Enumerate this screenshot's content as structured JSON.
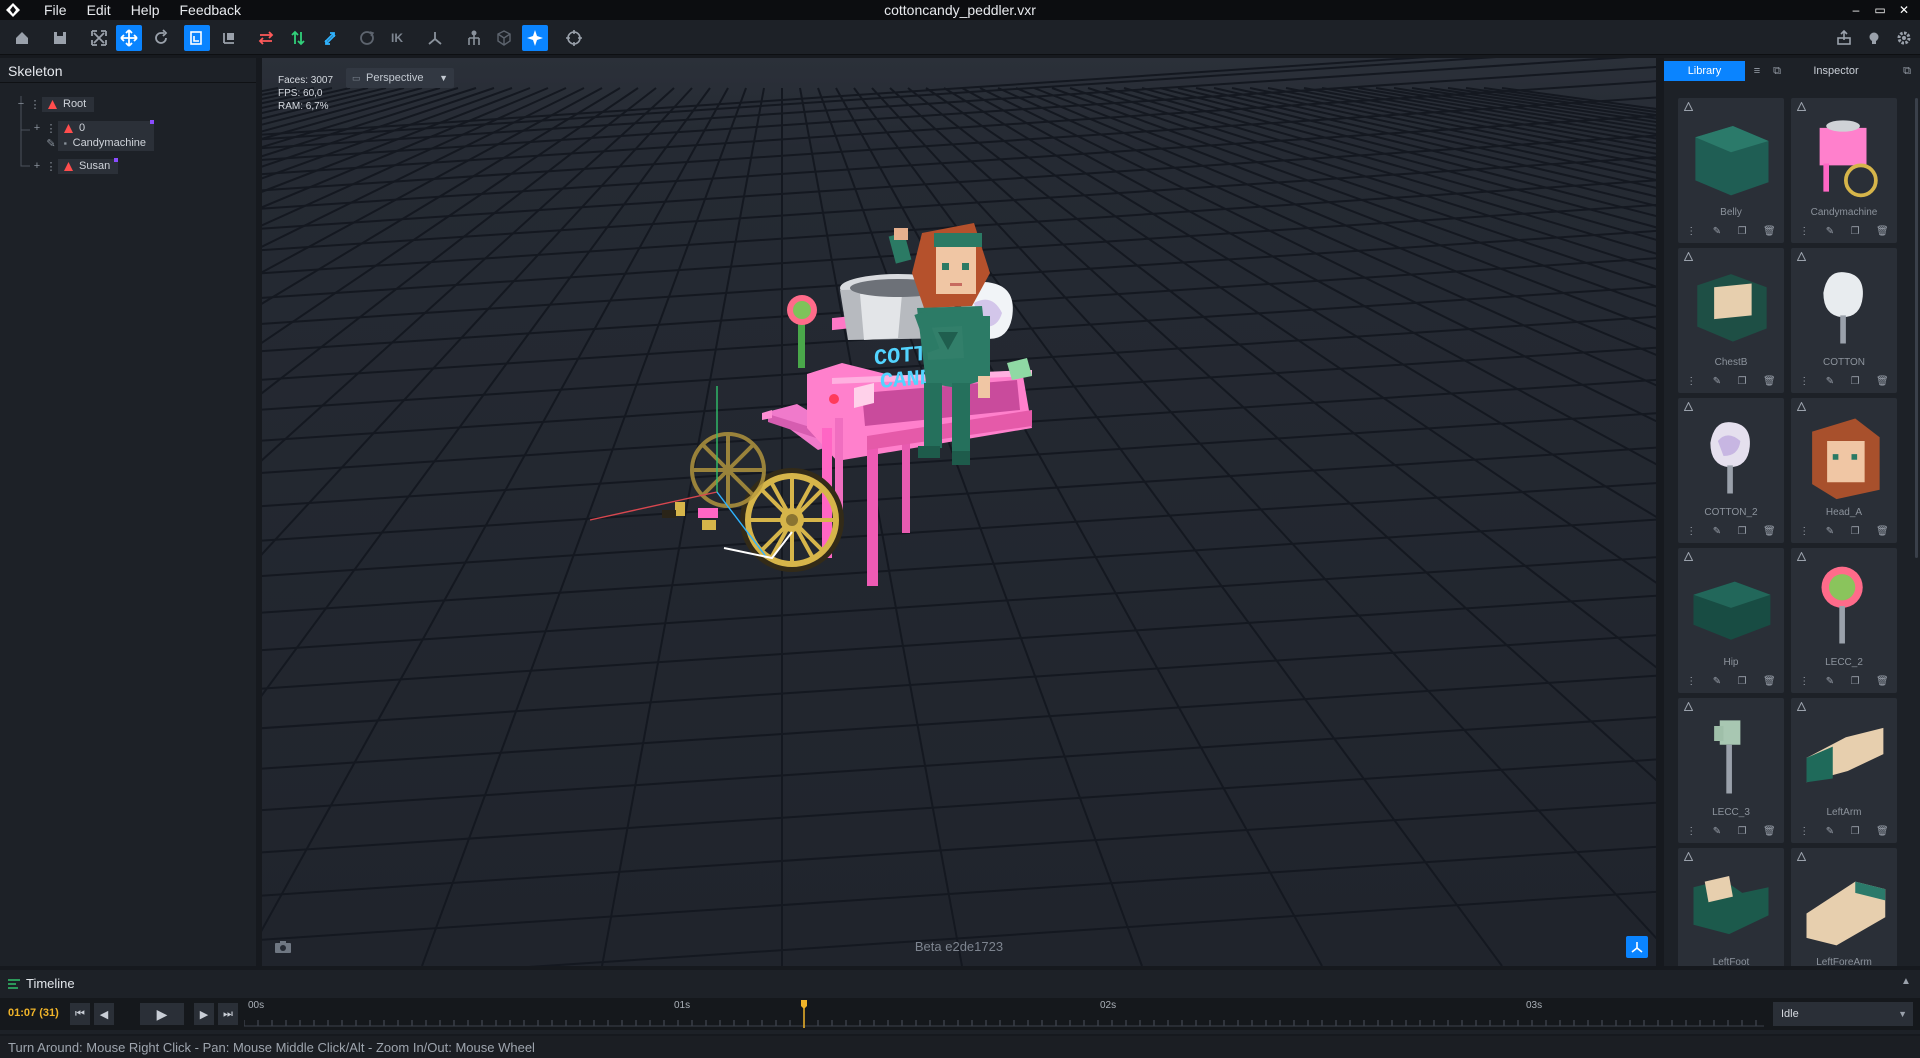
{
  "app": {
    "title": "cottoncandy_peddler.vxr",
    "menu": [
      "File",
      "Edit",
      "Help",
      "Feedback"
    ],
    "window_controls": [
      "–",
      "▭",
      "✕"
    ]
  },
  "toolbar": {
    "ik_label": "IK",
    "accent": "#0a84ff"
  },
  "skeleton": {
    "title": "Skeleton",
    "nodes": {
      "root": "Root",
      "zero": "0",
      "candymachine": "Candymachine",
      "susan": "Susan"
    }
  },
  "viewport": {
    "stats": {
      "faces": "Faces: 3007",
      "fps": "FPS: 60,0",
      "ram": "RAM: 6,7%"
    },
    "camera_mode": "Perspective",
    "build": "Beta e2de1723"
  },
  "library": {
    "tab_library": "Library",
    "tab_inspector": "Inspector",
    "items": [
      {
        "name": "Belly"
      },
      {
        "name": "Candymachine"
      },
      {
        "name": "ChestB"
      },
      {
        "name": "COTTON"
      },
      {
        "name": "COTTON_2"
      },
      {
        "name": "Head_A"
      },
      {
        "name": "Hip"
      },
      {
        "name": "LECC_2"
      },
      {
        "name": "LECC_3"
      },
      {
        "name": "LeftArm"
      },
      {
        "name": "LeftFoot"
      },
      {
        "name": "LeftForeArm"
      }
    ]
  },
  "timeline": {
    "title": "Timeline",
    "current_time": "01:07 (31)",
    "ticks": [
      "00s",
      "01s",
      "02s",
      "03s"
    ],
    "animation": "Idle",
    "playhead_color": "#f0b429"
  },
  "status": {
    "hint": "Turn Around: Mouse Right Click - Pan: Mouse Middle Click/Alt - Zoom In/Out: Mouse Wheel"
  }
}
